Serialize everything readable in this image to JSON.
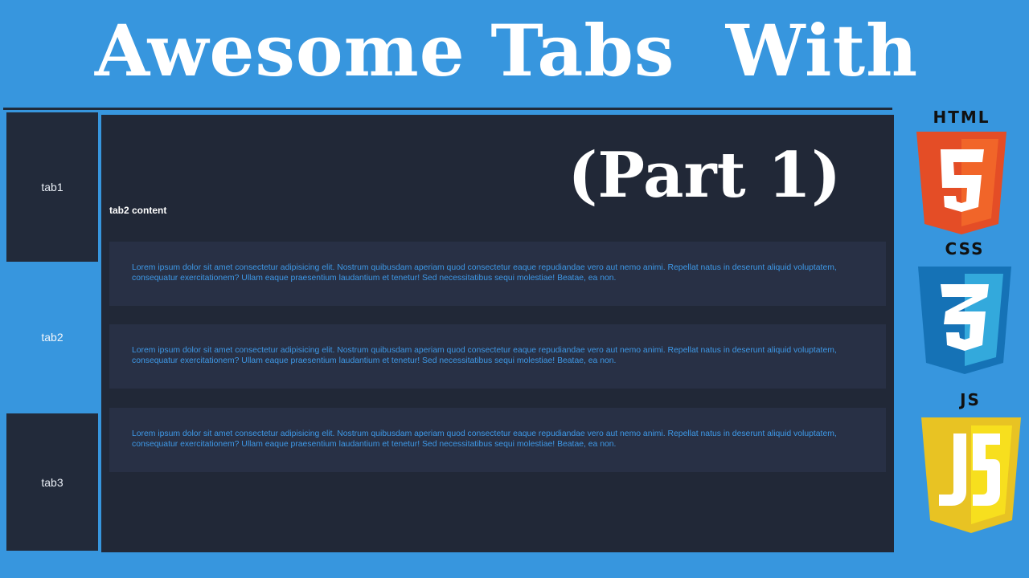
{
  "headline": "Awesome Tabs  With",
  "subtitle": "(Part 1)",
  "tabs": [
    {
      "label": "tab1",
      "active": false
    },
    {
      "label": "tab2",
      "active": true
    },
    {
      "label": "tab3",
      "active": false
    }
  ],
  "content": {
    "title": "tab2 content",
    "paragraphs": [
      "Lorem ipsum dolor sit amet consectetur adipisicing elit. Nostrum quibusdam aperiam quod consectetur eaque repudiandae vero aut nemo animi. Repellat natus in deserunt aliquid voluptatem, consequatur exercitationem? Ullam eaque praesentium laudantium et tenetur! Sed necessitatibus sequi molestiae! Beatae, ea non.",
      "Lorem ipsum dolor sit amet consectetur adipisicing elit. Nostrum quibusdam aperiam quod consectetur eaque repudiandae vero aut nemo animi. Repellat natus in deserunt aliquid voluptatem, consequatur exercitationem? Ullam eaque praesentium laudantium et tenetur! Sed necessitatibus sequi molestiae! Beatae, ea non.",
      "Lorem ipsum dolor sit amet consectetur adipisicing elit. Nostrum quibusdam aperiam quod consectetur eaque repudiandae vero aut nemo animi. Repellat natus in deserunt aliquid voluptatem, consequatur exercitationem? Ullam eaque praesentium laudantium et tenetur! Sed necessitatibus sequi molestiae! Beatae, ea non."
    ]
  },
  "logos": [
    {
      "label": "HTML",
      "glyph": "5",
      "icon": "html5-icon",
      "color": "#e44d26",
      "color_light": "#f16529"
    },
    {
      "label": "CSS",
      "glyph": "3",
      "icon": "css3-icon",
      "color": "#1572b6",
      "color_light": "#33a9dc"
    },
    {
      "label": "JS",
      "glyph": "JS",
      "icon": "javascript-icon",
      "color": "#e8c323",
      "color_light": "#f7df1e"
    }
  ],
  "colors": {
    "background": "#3796de",
    "panel": "#212837",
    "card": "#283045",
    "tab_inactive": "#222a3a",
    "tab_active": "#3796de",
    "paragraph_text": "#3e98e6"
  }
}
